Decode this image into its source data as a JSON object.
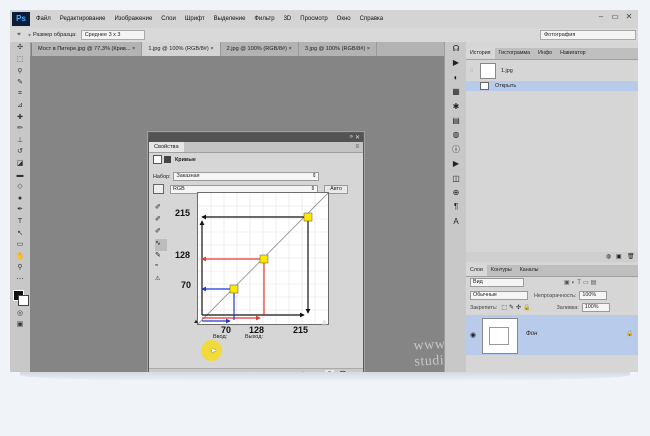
{
  "app": {
    "logo": "Ps",
    "menu": [
      "Файл",
      "Редактирование",
      "Изображение",
      "Слои",
      "Шрифт",
      "Выделение",
      "Фильтр",
      "3D",
      "Просмотр",
      "Окно",
      "Справка"
    ],
    "window_controls": [
      "–",
      "▭",
      "✕"
    ]
  },
  "options_bar": {
    "sample_size_label": "Размер образца:",
    "sample_size_value": "Среднее 3 x 3",
    "workspace_value": "Фотография"
  },
  "doc_tabs": [
    {
      "label": "Мост в Питере.jpg @ 77,3% (Крив...",
      "close": "×"
    },
    {
      "label": "1.jpg @ 100% (RGB/8#)",
      "close": "×"
    },
    {
      "label": "2.jpg @ 100% (RGB/8#)",
      "close": "×"
    },
    {
      "label": "3.jpg @ 100% (RGB/8#)",
      "close": "×"
    }
  ],
  "properties": {
    "tab_label": "Свойства",
    "panel_name": "Кривые",
    "preset_label": "Набор:",
    "preset_value": "Заказная",
    "channel_value": "RGB",
    "auto_button": "Авто",
    "input_label": "Ввод:",
    "output_label": "Выход:",
    "ann": {
      "v215": "215",
      "v128": "128",
      "v70": "70",
      "x70": "70",
      "x128": "128",
      "x215": "215"
    }
  },
  "history": {
    "tabs": [
      "История",
      "Гистограмма",
      "Инфо",
      "Навигатор"
    ],
    "snapshot_label": "1.jpg",
    "state_label": "Открыть"
  },
  "layers": {
    "tabs": [
      "Слои",
      "Контуры",
      "Каналы"
    ],
    "filter_value": "Вид",
    "blend_mode": "Обычные",
    "opacity_label": "Непрозрачность:",
    "opacity_value": "100%",
    "lock_label": "Закрепить:",
    "fill_label": "Заливка:",
    "fill_value": "100%",
    "layer_name": "Фон"
  },
  "watermark": "www.photoshop-studio.ru",
  "colors": {
    "arrow_black": "#111111",
    "arrow_red": "#e53935",
    "arrow_blue": "#1f3bd1",
    "point_yellow": "#ffe800",
    "cursor_yellow": "#f4dc2a"
  }
}
